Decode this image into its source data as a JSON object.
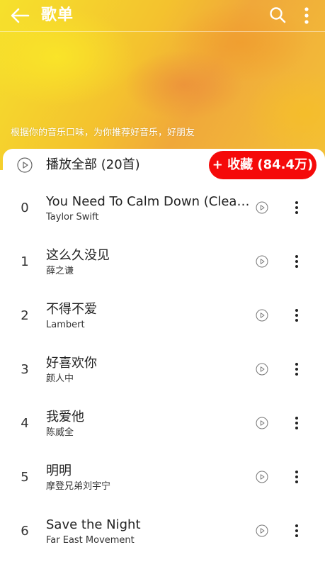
{
  "header": {
    "title": "歌单",
    "description": "根据你的音乐口味，为你推荐好音乐，好朋友"
  },
  "toolbar": {
    "play_all_label": "播放全部 (20首)",
    "collect_label": "+ 收藏 (84.4万)"
  },
  "songs": [
    {
      "index": "0",
      "title": "You Need To Calm Down (Clean Version)",
      "artist": "Taylor Swift"
    },
    {
      "index": "1",
      "title": "这么久没见",
      "artist": "薛之谦"
    },
    {
      "index": "2",
      "title": "不得不爱",
      "artist": "Lambert"
    },
    {
      "index": "3",
      "title": "好喜欢你",
      "artist": "颜人中"
    },
    {
      "index": "4",
      "title": "我爱他",
      "artist": "陈威全"
    },
    {
      "index": "5",
      "title": "明明",
      "artist": "摩登兄弟刘宇宁"
    },
    {
      "index": "6",
      "title": "Save the Night",
      "artist": "Far East Movement"
    }
  ],
  "icons": {
    "back": "back-arrow-icon",
    "search": "search-icon",
    "more": "more-vertical-icon",
    "play": "play-circle-icon"
  },
  "colors": {
    "accent": "#f50a0a",
    "hero_yellow": "#f6e12c",
    "hero_orange": "#f0a83a"
  }
}
